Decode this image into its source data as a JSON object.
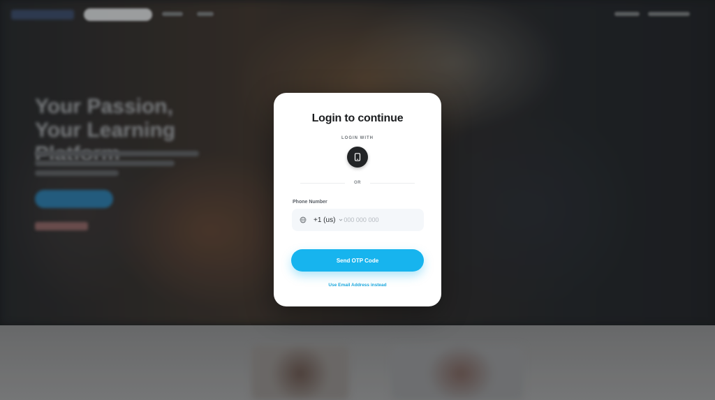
{
  "background": {
    "hero_title": "Your Passion, Your Learning Platform"
  },
  "modal": {
    "title": "Login to continue",
    "login_with_label": "LOGIN WITH",
    "login_method_icon": "phone-icon",
    "or_label": "OR",
    "phone_label": "Phone Number",
    "country_code": "+1 (us)",
    "phone_placeholder": "000 000 000",
    "submit_label": "Send OTP Code",
    "alt_link": "Use Email Address instead",
    "accent_color": "#17b4ee"
  }
}
